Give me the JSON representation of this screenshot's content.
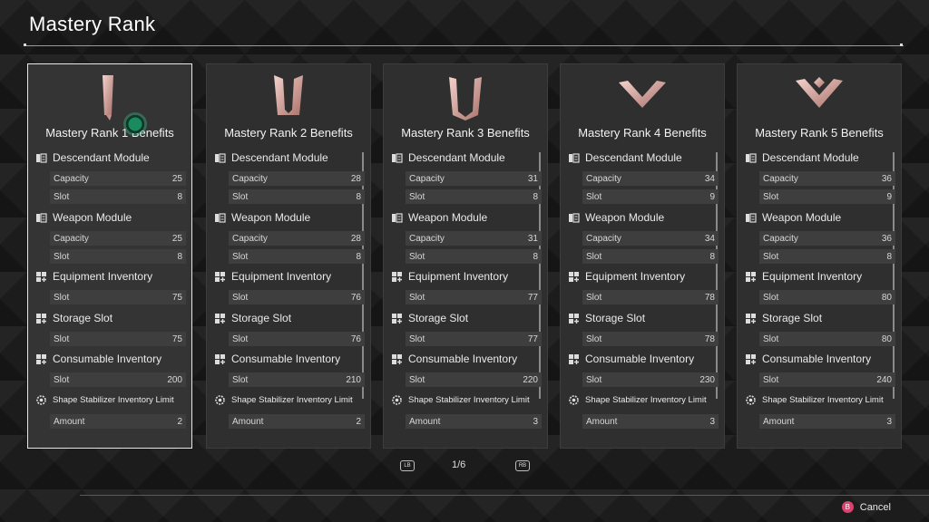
{
  "page": {
    "title": "Mastery Rank",
    "pager": {
      "current_page": "1/6",
      "left_button": "LB",
      "right_button": "RB"
    },
    "cancel": {
      "button": "B",
      "label": "Cancel"
    }
  },
  "colors": {
    "accent_emblem": "#d8a9a2",
    "cursor": "#1a8a5f",
    "cancel_button": "#d9436f"
  },
  "cards": [
    {
      "title": "Mastery Rank 1 Benefits",
      "emblem": "rank-1-emblem",
      "descendant_module": {
        "label": "Descendant Module",
        "capacity_label": "Capacity",
        "capacity": "25",
        "slot_label": "Slot",
        "slot": "8"
      },
      "weapon_module": {
        "label": "Weapon Module",
        "capacity_label": "Capacity",
        "capacity": "25",
        "slot_label": "Slot",
        "slot": "8"
      },
      "equipment_inventory": {
        "label": "Equipment Inventory",
        "slot_label": "Slot",
        "slot": "75"
      },
      "storage_slot": {
        "label": "Storage Slot",
        "slot_label": "Slot",
        "slot": "75"
      },
      "consumable_inventory": {
        "label": "Consumable Inventory",
        "slot_label": "Slot",
        "slot": "200"
      },
      "shape_stabilizer": {
        "label": "Shape Stabilizer Inventory Limit",
        "amount_label": "Amount",
        "amount": "2"
      }
    },
    {
      "title": "Mastery Rank 2 Benefits",
      "emblem": "rank-2-emblem",
      "descendant_module": {
        "label": "Descendant Module",
        "capacity_label": "Capacity",
        "capacity": "28",
        "slot_label": "Slot",
        "slot": "8"
      },
      "weapon_module": {
        "label": "Weapon Module",
        "capacity_label": "Capacity",
        "capacity": "28",
        "slot_label": "Slot",
        "slot": "8"
      },
      "equipment_inventory": {
        "label": "Equipment Inventory",
        "slot_label": "Slot",
        "slot": "76"
      },
      "storage_slot": {
        "label": "Storage Slot",
        "slot_label": "Slot",
        "slot": "76"
      },
      "consumable_inventory": {
        "label": "Consumable Inventory",
        "slot_label": "Slot",
        "slot": "210"
      },
      "shape_stabilizer": {
        "label": "Shape Stabilizer Inventory Limit",
        "amount_label": "Amount",
        "amount": "2"
      }
    },
    {
      "title": "Mastery Rank 3 Benefits",
      "emblem": "rank-3-emblem",
      "descendant_module": {
        "label": "Descendant Module",
        "capacity_label": "Capacity",
        "capacity": "31",
        "slot_label": "Slot",
        "slot": "8"
      },
      "weapon_module": {
        "label": "Weapon Module",
        "capacity_label": "Capacity",
        "capacity": "31",
        "slot_label": "Slot",
        "slot": "8"
      },
      "equipment_inventory": {
        "label": "Equipment Inventory",
        "slot_label": "Slot",
        "slot": "77"
      },
      "storage_slot": {
        "label": "Storage Slot",
        "slot_label": "Slot",
        "slot": "77"
      },
      "consumable_inventory": {
        "label": "Consumable Inventory",
        "slot_label": "Slot",
        "slot": "220"
      },
      "shape_stabilizer": {
        "label": "Shape Stabilizer Inventory Limit",
        "amount_label": "Amount",
        "amount": "3"
      }
    },
    {
      "title": "Mastery Rank 4 Benefits",
      "emblem": "rank-4-emblem",
      "descendant_module": {
        "label": "Descendant Module",
        "capacity_label": "Capacity",
        "capacity": "34",
        "slot_label": "Slot",
        "slot": "9"
      },
      "weapon_module": {
        "label": "Weapon Module",
        "capacity_label": "Capacity",
        "capacity": "34",
        "slot_label": "Slot",
        "slot": "8"
      },
      "equipment_inventory": {
        "label": "Equipment Inventory",
        "slot_label": "Slot",
        "slot": "78"
      },
      "storage_slot": {
        "label": "Storage Slot",
        "slot_label": "Slot",
        "slot": "78"
      },
      "consumable_inventory": {
        "label": "Consumable Inventory",
        "slot_label": "Slot",
        "slot": "230"
      },
      "shape_stabilizer": {
        "label": "Shape Stabilizer Inventory Limit",
        "amount_label": "Amount",
        "amount": "3"
      }
    },
    {
      "title": "Mastery Rank 5 Benefits",
      "emblem": "rank-5-emblem",
      "descendant_module": {
        "label": "Descendant Module",
        "capacity_label": "Capacity",
        "capacity": "36",
        "slot_label": "Slot",
        "slot": "9"
      },
      "weapon_module": {
        "label": "Weapon Module",
        "capacity_label": "Capacity",
        "capacity": "36",
        "slot_label": "Slot",
        "slot": "8"
      },
      "equipment_inventory": {
        "label": "Equipment Inventory",
        "slot_label": "Slot",
        "slot": "80"
      },
      "storage_slot": {
        "label": "Storage Slot",
        "slot_label": "Slot",
        "slot": "80"
      },
      "consumable_inventory": {
        "label": "Consumable Inventory",
        "slot_label": "Slot",
        "slot": "240"
      },
      "shape_stabilizer": {
        "label": "Shape Stabilizer Inventory Limit",
        "amount_label": "Amount",
        "amount": "3"
      }
    }
  ]
}
